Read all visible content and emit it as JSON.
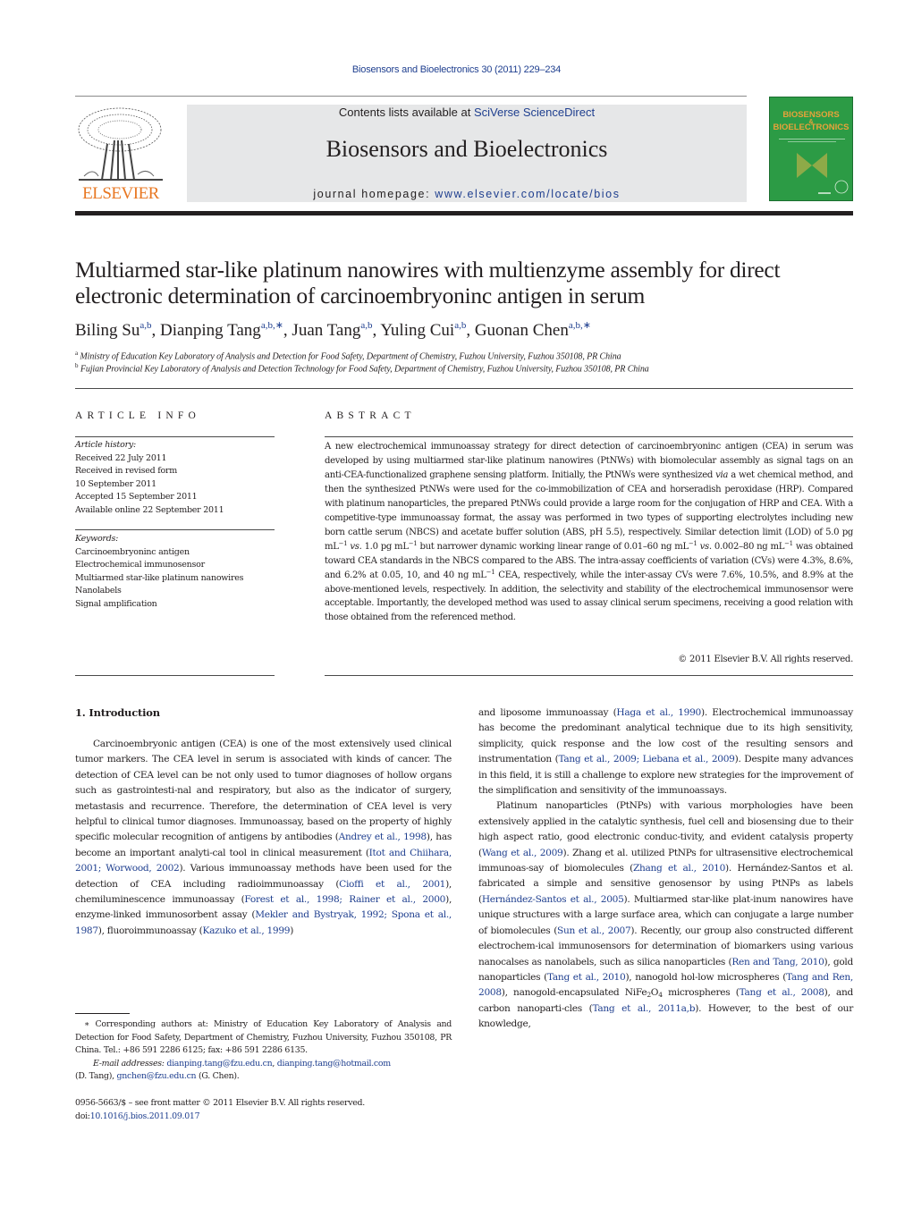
{
  "header": {
    "journal_ref": "Biosensors and Bioelectronics 30 (2011) 229–234",
    "contents_prefix": "Contents lists available at ",
    "contents_link": "SciVerse ScienceDirect",
    "journal_title": "Biosensors and Bioelectronics",
    "homepage_prefix": "journal homepage: ",
    "homepage_link": "www.elsevier.com/locate/bios",
    "publisher_logo_text": "ELSEVIER",
    "cover_title_line1": "BIOSENSORS",
    "cover_title_amp": "&",
    "cover_title_line2": "BIOELECTRONICS",
    "colors": {
      "link": "#1f3f8f",
      "elsevier_orange": "#e87722",
      "cover_green": "#2c9b45",
      "header_gray": "#e6e7e8"
    }
  },
  "article": {
    "title": "Multiarmed star-like platinum nanowires with multienzyme assembly for direct electronic determination of carcinoembryoninc antigen in serum",
    "authors": [
      {
        "name": "Biling Su",
        "sup": "a,b",
        "sep": ", "
      },
      {
        "name": "Dianping Tang",
        "sup": "a,b,∗",
        "sep": ", "
      },
      {
        "name": "Juan Tang",
        "sup": "a,b",
        "sep": ", "
      },
      {
        "name": "Yuling Cui",
        "sup": "a,b",
        "sep": ", "
      },
      {
        "name": "Guonan Chen",
        "sup": "a,b,∗",
        "sep": ""
      }
    ],
    "affiliations": [
      {
        "mark": "a",
        "text": "Ministry of Education Key Laboratory of Analysis and Detection for Food Safety, Department of Chemistry, Fuzhou University, Fuzhou 350108, PR China"
      },
      {
        "mark": "b",
        "text": "Fujian Provincial Key Laboratory of Analysis and Detection Technology for Food Safety, Department of Chemistry, Fuzhou University, Fuzhou 350108, PR China"
      }
    ]
  },
  "article_info": {
    "heading": "ARTICLE INFO",
    "history_label": "Article history:",
    "history": [
      "Received 22 July 2011",
      "Received in revised form",
      "10 September 2011",
      "Accepted 15 September 2011",
      "Available online 22 September 2011"
    ],
    "keywords_label": "Keywords:",
    "keywords": [
      "Carcinoembryoninc antigen",
      "Electrochemical immunosensor",
      "Multiarmed star-like platinum nanowires",
      "Nanolabels",
      "Signal amplification"
    ]
  },
  "abstract": {
    "heading": "ABSTRACT",
    "parts": {
      "p1": "A new electrochemical immunoassay strategy for direct detection of carcinoembryoninc antigen (CEA) in serum was developed by using multiarmed star-like platinum nanowires (PtNWs) with biomolecular assembly as signal tags on an anti-CEA-functionalized graphene sensing platform. Initially, the PtNWs were synthesized ",
      "via": "via",
      "p2": " a wet chemical method, and then the synthesized PtNWs were used for the co-immobilization of CEA and horseradish peroxidase (HRP). Compared with platinum nanoparticles, the prepared PtNWs could provide a large room for the conjugation of HRP and CEA. With a competitive-type immunoassay format, the assay was performed in two types of supporting electrolytes including new born cattle serum (NBCS) and acetate buffer solution (ABS, pH 5.5), respectively. Similar detection limit (LOD) of 5.0 pg mL",
      "minus1": "−1",
      "vs": "vs.",
      "p3": " 1.0 pg mL",
      "p4": " but narrower dynamic working linear range of 0.01–60 ng mL",
      "p5": "0.002–80 ng mL",
      "p6": " was obtained toward CEA standards in the NBCS compared to the ABS. The intra-assay coefficients of variation (CVs) were 4.3%, 8.6%, and 6.2% at 0.05, 10, and 40 ng mL",
      "p7": " CEA, respectively, while the inter-assay CVs were 7.6%, 10.5%, and 8.9% at the above-mentioned levels, respectively. In addition, the selectivity and stability of the electrochemical immunosensor were acceptable. Importantly, the developed method was used to assay clinical serum specimens, receiving a good relation with those obtained from the referenced method."
    },
    "copyright": "© 2011 Elsevier B.V. All rights reserved."
  },
  "intro": {
    "heading": "1.  Introduction",
    "left": {
      "t1": "Carcinoembryonic antigen (CEA) is one of the most extensively used clinical tumor markers. The CEA level in serum is associated with kinds of cancer. The detection of CEA level can be not only used to tumor diagnoses of hollow organs such as gastrointesti-nal and respiratory, but also as the indicator of surgery, metastasis and recurrence. Therefore, the determination of CEA level is very helpful to clinical tumor diagnoses. Immunoassay, based on the property of highly specific molecular recognition of antigens by antibodies (",
      "c1": "Andrey et al., 1998",
      "t2": "), has become an important analyti-cal tool in clinical measurement (",
      "c2": "Itot and Chiihara, 2001; Worwood, 2002",
      "t3": "). Various immunoassay methods have been used for the detection of CEA including radioimmunoassay (",
      "c3": "Cioffi et al., 2001",
      "t4": "), chemiluminescence immunoassay (",
      "c4": "Forest et al., 1998; Rainer et al., 2000",
      "t5": "), enzyme-linked immunosorbent assay (",
      "c5": "Mekler and Bystryak, 1992; Spona et al., 1987",
      "t6": "), fluoroimmunoassay (",
      "c6": "Kazuko et al., 1999",
      "t7": ")"
    },
    "right": {
      "t1": "and liposome immunoassay (",
      "c1": "Haga et al., 1990",
      "t2": "). Electrochemical immunoassay has become the predominant analytical technique due to its high sensitivity, simplicity, quick response and the low cost of the resulting sensors and instrumentation (",
      "c2": "Tang et al., 2009; Liebana et al., 2009",
      "t3": "). Despite many advances in this field, it is still a challenge to explore new strategies for the improvement of the simplification and sensitivity of the immunoassays.",
      "p2_t1": "Platinum nanoparticles (PtNPs) with various morphologies have been extensively applied in the catalytic synthesis, fuel cell and biosensing due to their high aspect ratio, good electronic conduc-tivity, and evident catalysis property (",
      "p2_c1": "Wang et al., 2009",
      "p2_t2": "). Zhang et al. utilized PtNPs for ultrasensitive electrochemical immunoas-say of biomolecules (",
      "p2_c2": "Zhang et al., 2010",
      "p2_t3": "). Hernández-Santos et al. fabricated a simple and sensitive genosensor by using PtNPs as labels (",
      "p2_c3": "Hernández-Santos et al., 2005",
      "p2_t4": "). Multiarmed star-like plat-inum nanowires have unique structures with a large surface area, which can conjugate a large number of biomolecules (",
      "p2_c4": "Sun et al., 2007",
      "p2_t5": "). Recently, our group also constructed different electrochem-ical immunosensors for determination of biomarkers using various nanocalses as nanolabels, such as silica nanoparticles (",
      "p2_c5": "Ren and Tang, 2010",
      "p2_t6": "), gold nanoparticles (",
      "p2_c6": "Tang et al., 2010",
      "p2_t7": "), nanogold hol-low microspheres (",
      "p2_c7": "Tang and Ren, 2008",
      "p2_t8": "), nanogold-encapsulated NiFe",
      "sub2": "2",
      "o": "O",
      "sub4": "4",
      "p2_t9": " microspheres (",
      "p2_c8": "Tang et al., 2008",
      "p2_t10": "), and carbon nanoparti-cles (",
      "p2_c9": "Tang et al., 2011a,b",
      "p2_t11": "). However, to the best of our knowledge,"
    }
  },
  "footnote": {
    "star": "∗",
    "corresponding": " Corresponding authors at: Ministry of Education Key Laboratory of Analysis and Detection for Food Safety, Department of Chemistry, Fuzhou University, Fuzhou 350108, PR China. Tel.: +86 591 2286 6125; fax: +86 591 2286 6135.",
    "email_label": "E-mail addresses:",
    "email1": "dianping.tang@fzu.edu.cn",
    "email2": "dianping.tang@hotmail.com",
    "who1": " (D. Tang), ",
    "email3": "gnchen@fzu.edu.cn",
    "who2": " (G. Chen)."
  },
  "front_matter": {
    "issn_line": "0956-5663/$ – see front matter © 2011 Elsevier B.V. All rights reserved.",
    "doi_prefix": "doi:",
    "doi": "10.1016/j.bios.2011.09.017"
  }
}
